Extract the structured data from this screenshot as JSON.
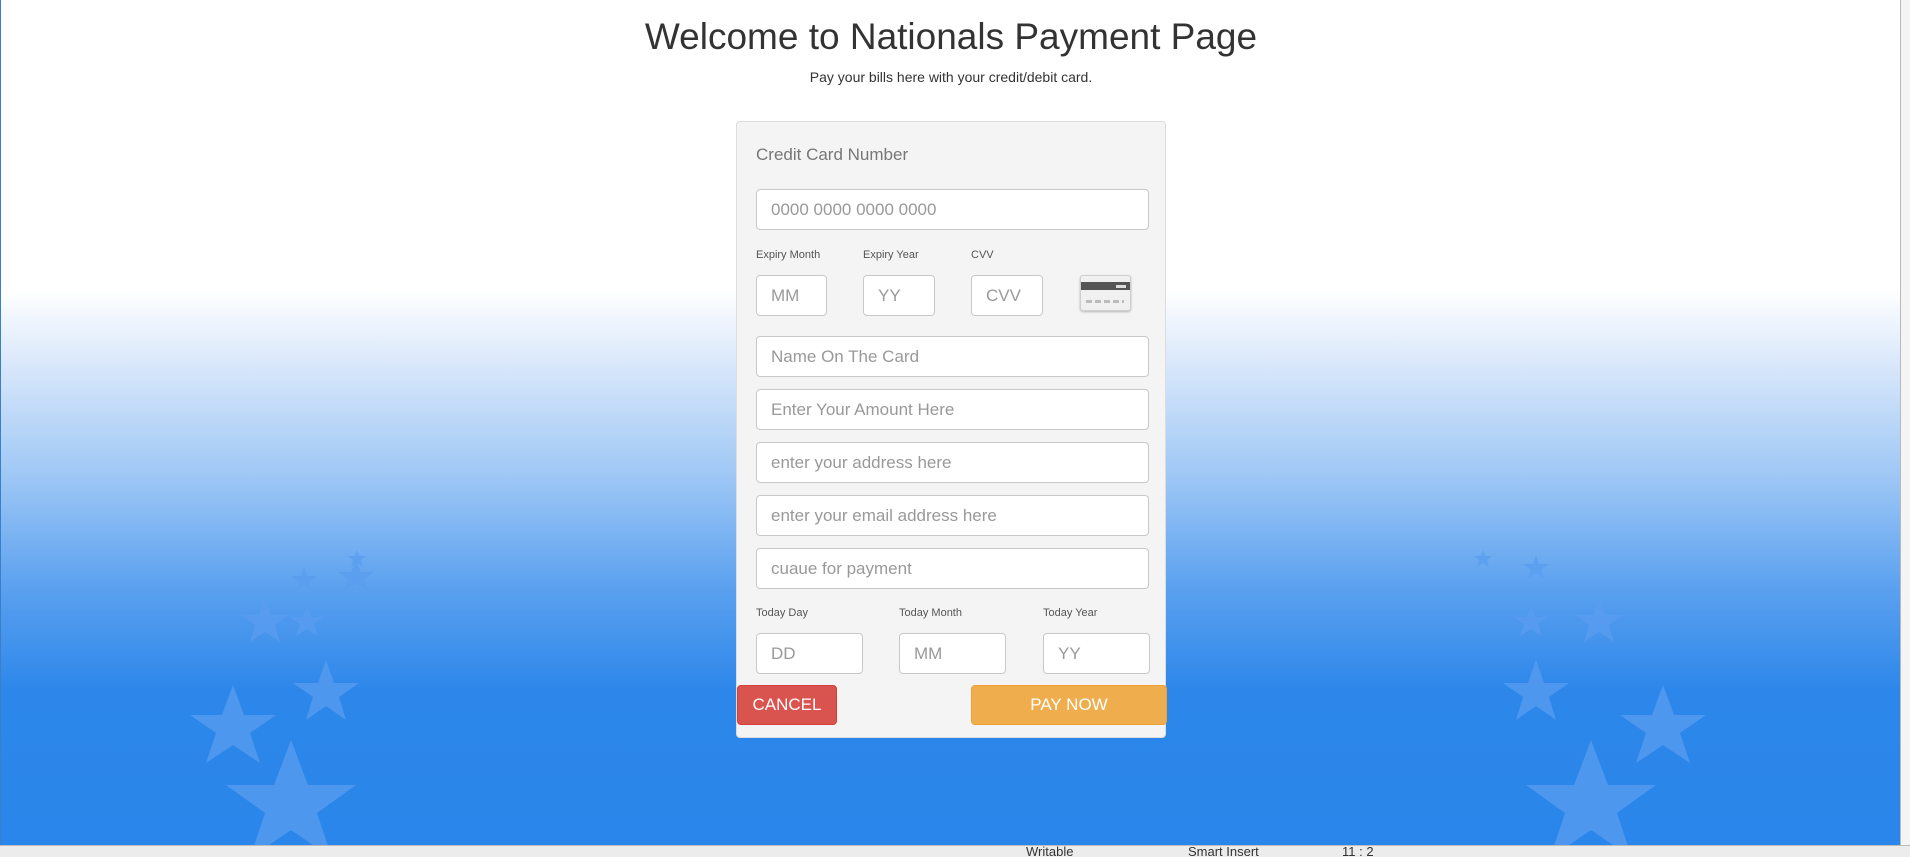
{
  "header": {
    "title": "Welcome to Nationals Payment Page",
    "subtitle": "Pay your bills here with your credit/debit card."
  },
  "form": {
    "card_number_label": "Credit Card Number",
    "card_number_placeholder": "0000 0000 0000 0000",
    "expiry_month_label": "Expiry Month",
    "expiry_month_placeholder": "MM",
    "expiry_year_label": "Expiry Year",
    "expiry_year_placeholder": "YY",
    "cvv_label": "CVV",
    "cvv_placeholder": "CVV",
    "card_icon": "credit-card-back-icon",
    "name_placeholder": "Name On The Card",
    "amount_placeholder": "Enter Your Amount Here",
    "address_placeholder": "enter your address here",
    "email_placeholder": "enter your email address here",
    "cause_placeholder": "cuaue for payment",
    "today_day_label": "Today Day",
    "today_day_placeholder": "DD",
    "today_month_label": "Today Month",
    "today_month_placeholder": "MM",
    "today_year_label": "Today Year",
    "today_year_placeholder": "YY"
  },
  "buttons": {
    "cancel_label": "CANCEL",
    "pay_label": "PAY NOW"
  },
  "colors": {
    "cancel": "#d9534f",
    "pay": "#f0ad4e",
    "background_blue": "#2a86ea"
  },
  "status_bar": {
    "mode": "Writable",
    "insert": "Smart Insert",
    "position": "11 : 2"
  }
}
